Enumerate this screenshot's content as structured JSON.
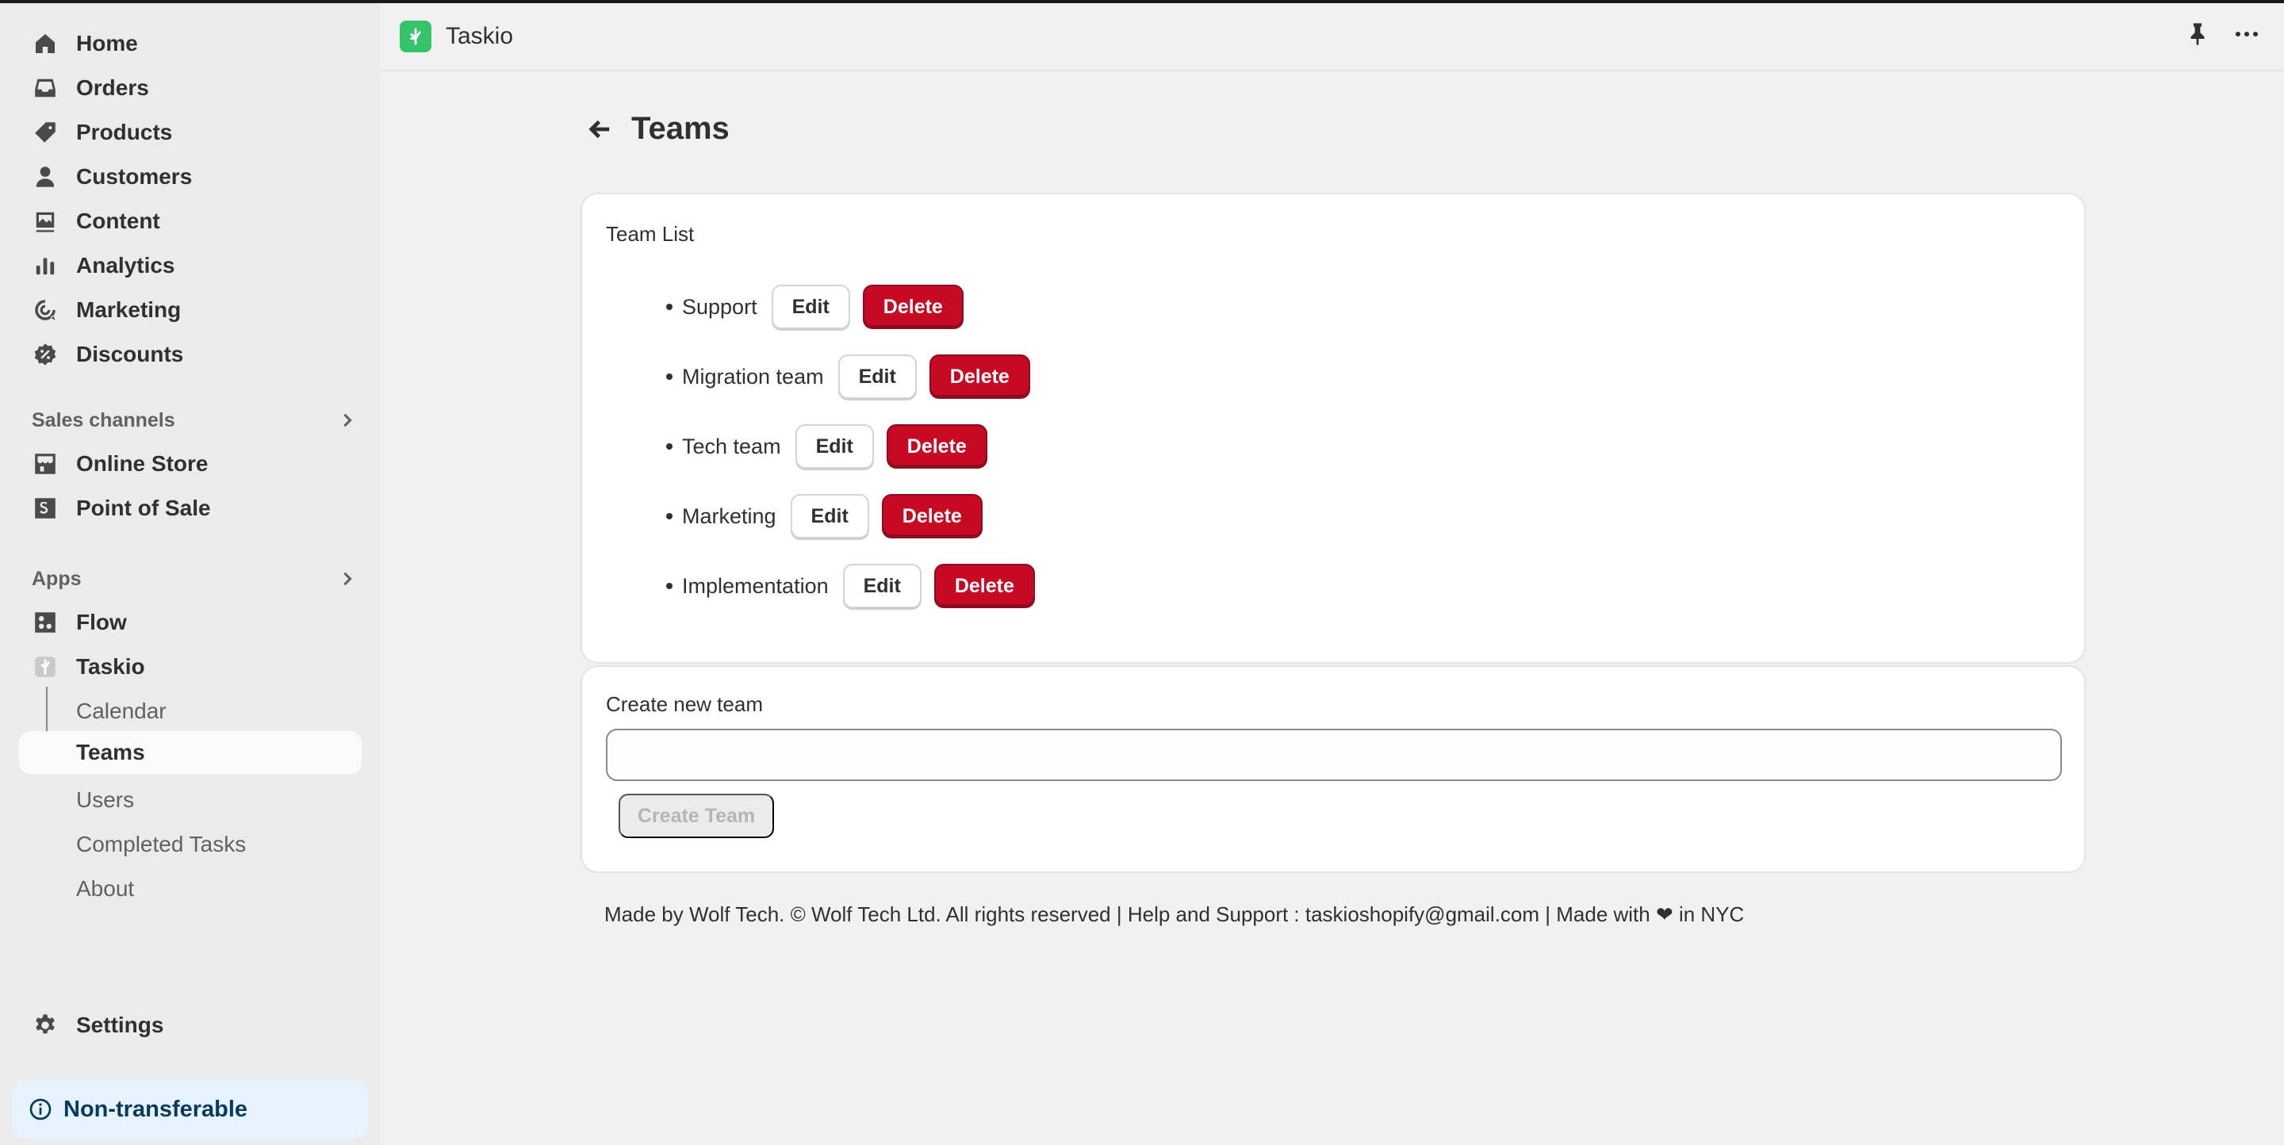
{
  "sidebar": {
    "main_items": [
      {
        "label": "Home",
        "icon": "home-icon"
      },
      {
        "label": "Orders",
        "icon": "inbox-icon"
      },
      {
        "label": "Products",
        "icon": "tag-icon"
      },
      {
        "label": "Customers",
        "icon": "person-icon"
      },
      {
        "label": "Content",
        "icon": "image-icon"
      },
      {
        "label": "Analytics",
        "icon": "bar-chart-icon"
      },
      {
        "label": "Marketing",
        "icon": "target-icon"
      },
      {
        "label": "Discounts",
        "icon": "discount-icon"
      }
    ],
    "sales_channels": {
      "heading": "Sales channels",
      "items": [
        {
          "label": "Online Store",
          "icon": "store-icon"
        },
        {
          "label": "Point of Sale",
          "icon": "pos-icon"
        }
      ]
    },
    "apps": {
      "heading": "Apps",
      "items": [
        {
          "label": "Flow",
          "icon": "flow-icon"
        },
        {
          "label": "Taskio",
          "icon": "taskio-icon"
        }
      ],
      "sub_items": [
        {
          "label": "Calendar"
        },
        {
          "label": "Teams",
          "active": true
        },
        {
          "label": "Users"
        },
        {
          "label": "Completed Tasks"
        },
        {
          "label": "About"
        }
      ]
    },
    "settings_label": "Settings",
    "notice_label": "Non-transferable"
  },
  "header": {
    "app_name": "Taskio"
  },
  "page": {
    "title": "Teams",
    "team_list_title": "Team List",
    "teams": [
      {
        "name": "Support",
        "edit_label": "Edit",
        "delete_label": "Delete"
      },
      {
        "name": "Migration team",
        "edit_label": "Edit",
        "delete_label": "Delete"
      },
      {
        "name": "Tech team",
        "edit_label": "Edit",
        "delete_label": "Delete"
      },
      {
        "name": "Marketing",
        "edit_label": "Edit",
        "delete_label": "Delete"
      },
      {
        "name": "Implementation",
        "edit_label": "Edit",
        "delete_label": "Delete"
      }
    ],
    "create_title": "Create new team",
    "create_input_value": "",
    "create_button_label": "Create Team",
    "footer": "Made by Wolf Tech. © Wolf Tech Ltd. All rights reserved | Help and Support : taskioshopify@gmail.com | Made with ❤ in NYC"
  },
  "colors": {
    "accent_delete": "#c70a24",
    "app_logo": "#36c46b",
    "notice_bg": "#e6f3fd"
  }
}
